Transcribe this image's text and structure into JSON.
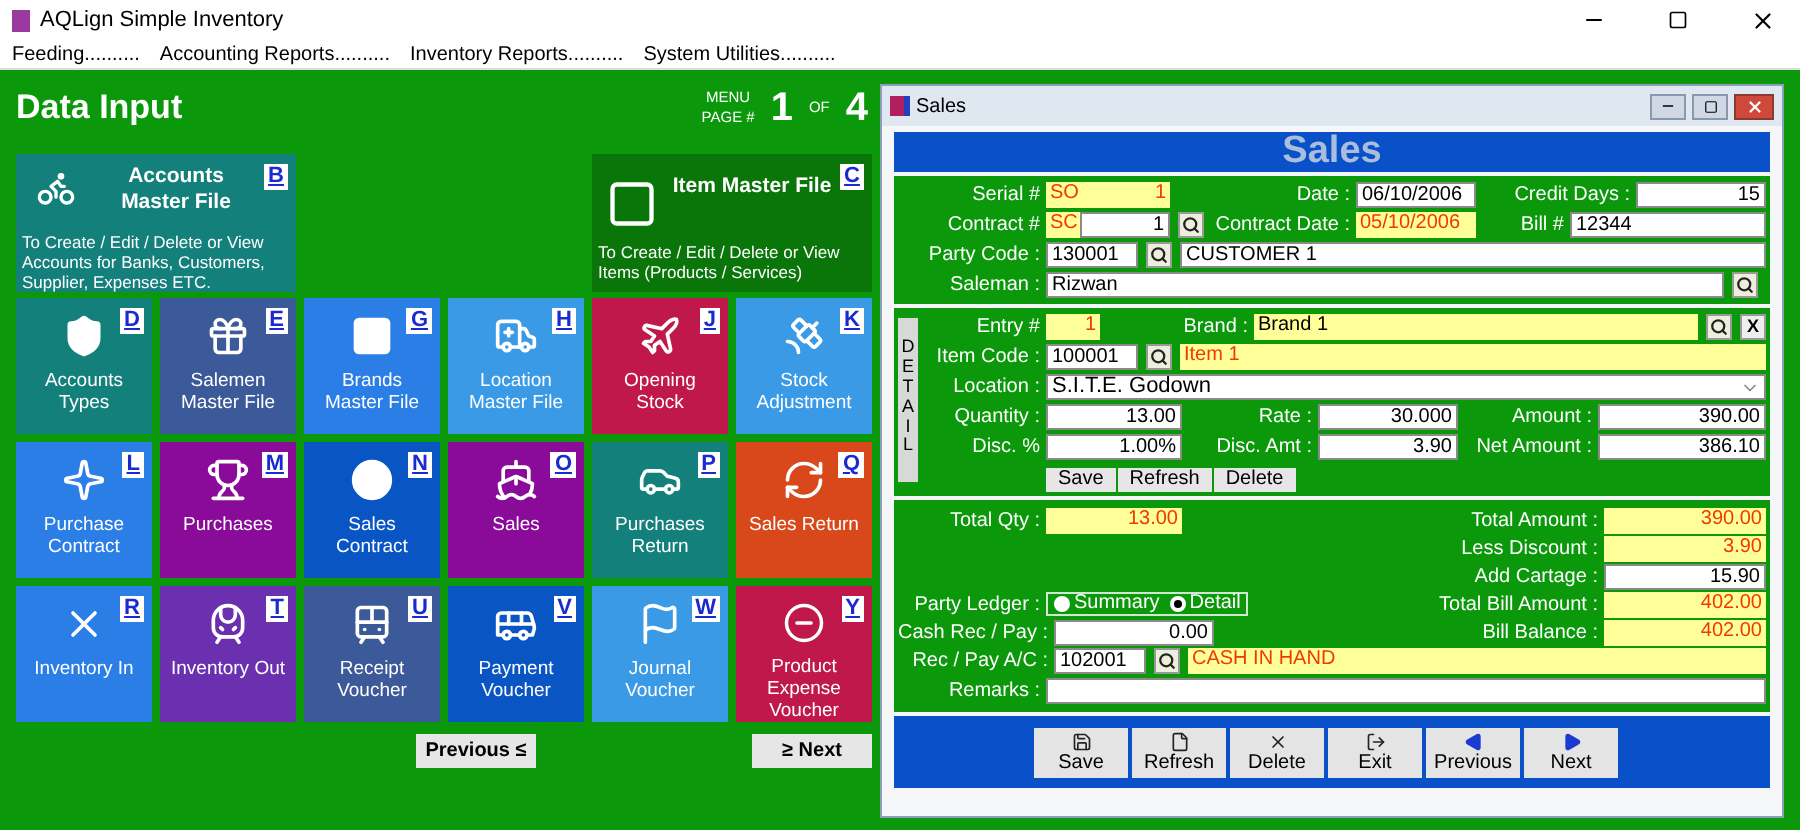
{
  "app": {
    "title": "AQLign Simple Inventory"
  },
  "menu": [
    "Feeding..........",
    "Accounting Reports..........",
    "Inventory Reports..........",
    "System Utilities.........."
  ],
  "data_input": {
    "title": "Data Input",
    "page_label": "MENU",
    "page_label_2": "PAGE #",
    "page": "1",
    "of": "OF",
    "total": "4",
    "big_tiles": [
      {
        "title": "Accounts Master File",
        "key": "B",
        "description": "To Create / Edit / Delete or View Accounts for Banks, Customers, Supplier, Expenses ETC.",
        "color": "#13807c"
      },
      {
        "title": "Item Master File",
        "key": "C",
        "description": "To Create / Edit / Delete or View Items (Products / Services)",
        "color": "#0a760a"
      }
    ],
    "tiles": [
      {
        "label": "Accounts Types",
        "key": "D",
        "color": "#13807c"
      },
      {
        "label": "Salemen Master File",
        "key": "E",
        "color": "#3c5a9a"
      },
      {
        "label": "Brands Master File",
        "key": "G",
        "color": "#2a7ee6"
      },
      {
        "label": "Location Master File",
        "key": "H",
        "color": "#3a9ae6"
      },
      {
        "label": "Opening Stock",
        "key": "J",
        "color": "#c0184a"
      },
      {
        "label": "Stock Adjustment",
        "key": "K",
        "color": "#3a9ae6"
      },
      {
        "label": "Purchase Contract",
        "key": "L",
        "color": "#2a7ee6"
      },
      {
        "label": "Purchases",
        "key": "M",
        "color": "#8a0a9a"
      },
      {
        "label": "Sales Contract",
        "key": "N",
        "color": "#0a55c4"
      },
      {
        "label": "Sales",
        "key": "O",
        "color": "#8a0a9a"
      },
      {
        "label": "Purchases Return",
        "key": "P",
        "color": "#13807c"
      },
      {
        "label": "Sales Return",
        "key": "Q",
        "color": "#d8481a"
      },
      {
        "label": "Inventory In",
        "key": "R",
        "color": "#2a7ee6"
      },
      {
        "label": "Inventory Out",
        "key": "T",
        "color": "#6a30b0"
      },
      {
        "label": "Receipt Voucher",
        "key": "U",
        "color": "#3c5a9a"
      },
      {
        "label": "Payment Voucher",
        "key": "V",
        "color": "#0a55c4"
      },
      {
        "label": "Journal Voucher",
        "key": "W",
        "color": "#3a9ae6"
      },
      {
        "label": "Product Expense Voucher",
        "key": "Y",
        "color": "#c0184a"
      }
    ],
    "buttons": [
      "Previous ≤",
      "≥ Next"
    ]
  },
  "sales": {
    "window_title": "Sales",
    "heading": "Sales",
    "serial": {
      "label": "Serial #",
      "prefix": {
        "value": "SO",
        "kind": "readonly"
      },
      "number": {
        "value": "1",
        "kind": "readonly"
      }
    },
    "date": {
      "label": "Date :",
      "value": "06/10/2006",
      "kind": "input"
    },
    "credit_days": {
      "label": "Credit Days :",
      "value": "15",
      "kind": "input"
    },
    "contract": {
      "label": "Contract #",
      "prefix": {
        "value": "SC",
        "kind": "readonly"
      },
      "number": {
        "value": "1",
        "kind": "input"
      }
    },
    "contract_date": {
      "label": "Contract Date :",
      "value": "05/10/2006",
      "kind": "readonly"
    },
    "bill": {
      "label": "Bill #",
      "value": "12344",
      "kind": "input"
    },
    "party": {
      "label": "Party Code :",
      "code": {
        "value": "130001",
        "kind": "input"
      },
      "name": {
        "value": "CUSTOMER 1",
        "kind": "input"
      }
    },
    "saleman": {
      "label": "Saleman :",
      "value": "Rizwan",
      "kind": "input"
    },
    "detail": {
      "tab": "DETAIL",
      "entry": {
        "label": "Entry #",
        "value": "1",
        "kind": "readonly"
      },
      "brand": {
        "label": "Brand :",
        "value": "Brand 1",
        "kind": "highlight"
      },
      "clear_button": "X",
      "item": {
        "label": "Item Code :",
        "code": {
          "value": "100001",
          "kind": "input"
        },
        "name": {
          "value": "Item 1",
          "kind": "readonly"
        }
      },
      "location": {
        "label": "Location :",
        "value": "S.I.T.E. Godown",
        "kind": "input"
      },
      "quantity": {
        "label": "Quantity :",
        "value": "13.00",
        "kind": "input"
      },
      "rate": {
        "label": "Rate :",
        "value": "30.000",
        "kind": "input"
      },
      "amount": {
        "label": "Amount :",
        "value": "390.00",
        "kind": "input"
      },
      "discount_pct": {
        "label": "Disc. %",
        "value": "1.00%",
        "kind": "input"
      },
      "discount_amt": {
        "label": "Disc. Amt :",
        "value": "3.90",
        "kind": "input"
      },
      "net_amount": {
        "label": "Net Amount :",
        "value": "386.10",
        "kind": "input"
      },
      "buttons": [
        "Save",
        "Refresh",
        "Delete"
      ]
    },
    "totals": {
      "total_qty": {
        "label": "Total Qty :",
        "value": "13.00",
        "kind": "readonly"
      },
      "party_ledger": {
        "label": "Party Ledger :",
        "options": [
          {
            "label": "Summary",
            "selected": false
          },
          {
            "label": "Detail",
            "selected": true
          }
        ]
      },
      "cash_rec_pay": {
        "label": "Cash Rec / Pay :",
        "value": "0.00",
        "kind": "input"
      },
      "summary": [
        {
          "label": "Total Amount :",
          "value": "390.00",
          "kind": "readonly"
        },
        {
          "label": "Less Discount :",
          "value": "3.90",
          "kind": "readonly"
        },
        {
          "label": "Add Cartage :",
          "value": "15.90",
          "kind": "input"
        },
        {
          "label": "Total Bill Amount :",
          "value": "402.00",
          "kind": "readonly"
        },
        {
          "label": "Bill Balance :",
          "value": "402.00",
          "kind": "readonly"
        }
      ],
      "rec_pay_account": {
        "label": "Rec / Pay A/C :",
        "code": {
          "value": "102001",
          "kind": "input"
        },
        "name": {
          "value": "CASH IN HAND",
          "kind": "readonly"
        }
      },
      "remarks": {
        "label": "Remarks :",
        "kind": "input"
      }
    },
    "toolbar": [
      "Save",
      "Refresh",
      "Delete",
      "Exit",
      "Previous",
      "Next"
    ]
  }
}
